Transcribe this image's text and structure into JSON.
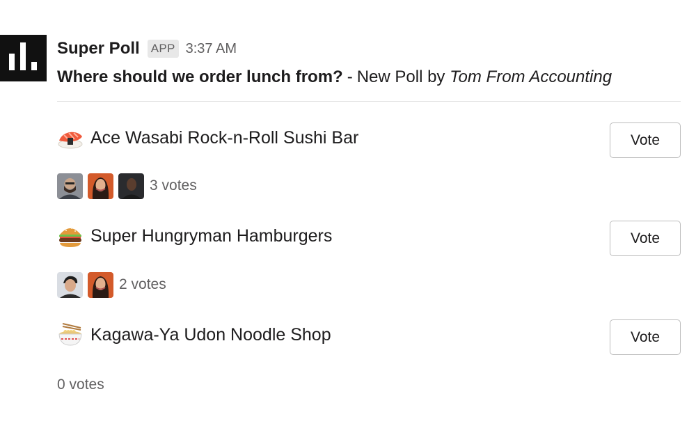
{
  "app": {
    "name": "Super Poll",
    "badge": "APP",
    "timestamp": "3:37 AM",
    "icon": "bar-chart-icon"
  },
  "poll": {
    "question": "Where should we order lunch from?",
    "separator": "-",
    "subtitle": "New Poll by",
    "author": "Tom From Accounting"
  },
  "options": [
    {
      "label": "Ace Wasabi Rock-n-Roll Sushi Bar",
      "icon": "sushi-icon",
      "vote_label": "Vote",
      "vote_count": "3 votes",
      "voters": [
        "voter-avatar-1",
        "voter-avatar-2",
        "voter-avatar-3"
      ]
    },
    {
      "label": "Super Hungryman Hamburgers",
      "icon": "hamburger-icon",
      "vote_label": "Vote",
      "vote_count": "2 votes",
      "voters": [
        "voter-avatar-4",
        "voter-avatar-2"
      ]
    },
    {
      "label": "Kagawa-Ya Udon Noodle Shop",
      "icon": "noodle-bowl-icon",
      "vote_label": "Vote",
      "vote_count": "0 votes",
      "voters": []
    }
  ],
  "colors": {
    "text": "#1d1c1d",
    "muted": "#616061",
    "app_icon_bg": "#111111",
    "badge_bg": "#e8e8e8",
    "button_border": "#bcbcbc"
  }
}
